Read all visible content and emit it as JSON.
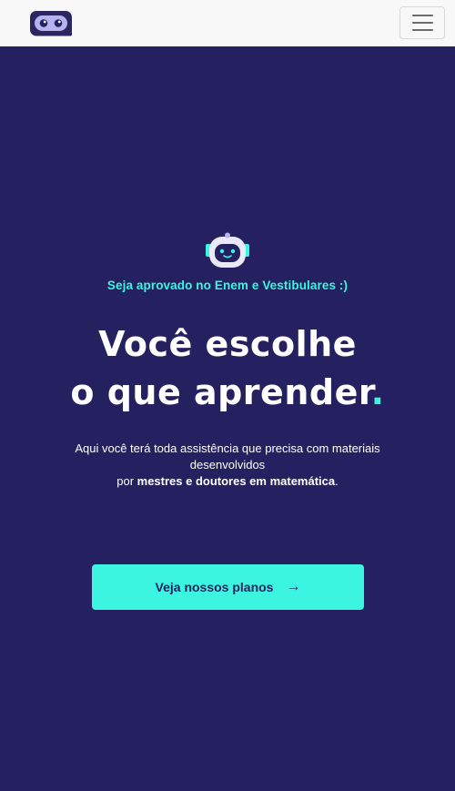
{
  "navbar": {
    "logo_icon": "robot-face-logo",
    "menu_icon": "hamburger-menu-icon"
  },
  "hero": {
    "mascot_icon": "robot-mascot-icon",
    "tagline": "Seja aprovado no Enem e Vestibulares :)",
    "headline_line1": "Você escolhe",
    "headline_line2": "o que aprender",
    "headline_dot": ".",
    "description_text1": "Aqui você terá toda assistência que precisa com materiais desenvolvidos",
    "description_text2": "por ",
    "description_strong": "mestres e doutores em matemática",
    "description_end": ".",
    "cta_label": "Veja nossos planos",
    "cta_icon": "arrow-right-icon",
    "cta_arrow": "→"
  },
  "colors": {
    "background": "#25205f",
    "accent": "#3cf5e0",
    "navbar": "#f8f8f8",
    "text": "#ffffff"
  }
}
